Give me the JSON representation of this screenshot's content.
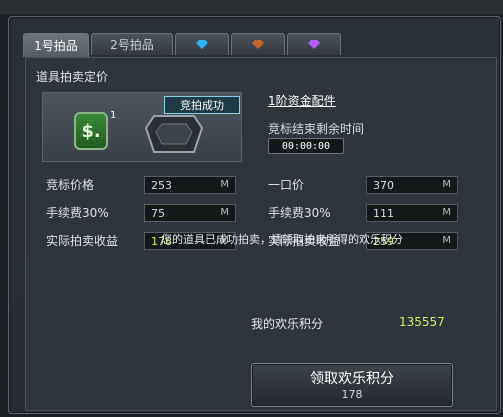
{
  "tabs": [
    {
      "label": "1号拍品",
      "active": true
    },
    {
      "label": "2号拍品",
      "active": false
    },
    {
      "icon": "blue-gem-icon",
      "color": "#2fb6ff"
    },
    {
      "icon": "orange-gem-icon",
      "color": "#c7652a"
    },
    {
      "icon": "purple-gem-icon",
      "color": "#b45cff"
    }
  ],
  "section_title": "道具拍卖定价",
  "item": {
    "success_badge": "竞拍成功",
    "icon_symbol": "$.",
    "count": "1",
    "name": "1阶资金配件"
  },
  "timer": {
    "label": "竞标结束剩余时间",
    "value": "00:00:00"
  },
  "bid": {
    "rows": [
      {
        "label": "竞标价格",
        "value": "253",
        "unit": "M"
      },
      {
        "label": "手续费30%",
        "value": "75",
        "unit": "M"
      },
      {
        "label": "实际拍卖收益",
        "value": "178",
        "unit": "M"
      }
    ]
  },
  "buyout": {
    "rows": [
      {
        "label": "一口价",
        "value": "370",
        "unit": "M"
      },
      {
        "label": "手续费30%",
        "value": "111",
        "unit": "M"
      },
      {
        "label": "实际拍卖收益",
        "value": "259",
        "unit": "M"
      }
    ]
  },
  "message": "您的道具已成功拍卖，请领取拍卖所得的欢乐积分",
  "points": {
    "label": "我的欢乐积分",
    "value": "135557"
  },
  "claim_button": {
    "label": "领取欢乐积分",
    "sub": "178"
  },
  "colors": {
    "accent_green": "#c8f26c",
    "badge_border": "#8ad0e6"
  }
}
